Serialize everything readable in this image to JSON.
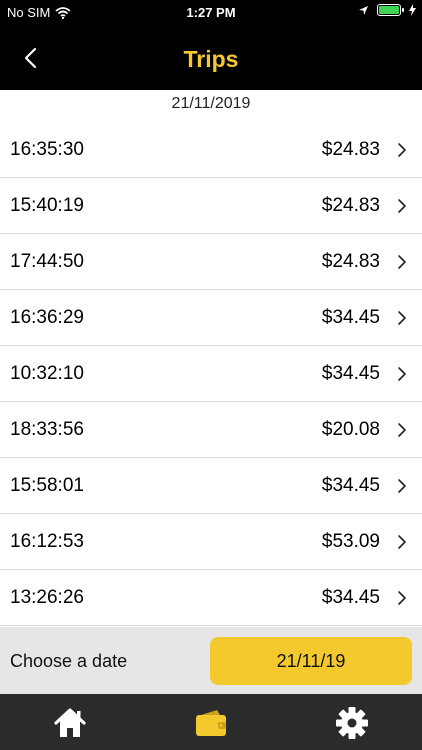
{
  "status_bar": {
    "carrier": "No SIM",
    "time": "1:27 PM"
  },
  "header": {
    "title": "Trips",
    "back_icon": "chevron-left-icon"
  },
  "date_header": "21/11/2019",
  "trips": [
    {
      "time": "16:35:30",
      "amount": "$24.83"
    },
    {
      "time": "15:40:19",
      "amount": "$24.83"
    },
    {
      "time": "17:44:50",
      "amount": "$24.83"
    },
    {
      "time": "16:36:29",
      "amount": "$34.45"
    },
    {
      "time": "10:32:10",
      "amount": "$34.45"
    },
    {
      "time": "18:33:56",
      "amount": "$20.08"
    },
    {
      "time": "15:58:01",
      "amount": "$34.45"
    },
    {
      "time": "16:12:53",
      "amount": "$53.09"
    },
    {
      "time": "13:26:26",
      "amount": "$34.45"
    }
  ],
  "date_picker": {
    "label": "Choose a date",
    "value": "21/11/19"
  },
  "tabs": [
    {
      "icon": "home-icon",
      "active": false
    },
    {
      "icon": "wallet-icon",
      "active": true
    },
    {
      "icon": "settings-icon",
      "active": false
    }
  ],
  "colors": {
    "accent": "#f4c92e",
    "nav_background": "#000000",
    "tab_background": "#2b2b2b",
    "picker_background": "#e6e6e6"
  }
}
